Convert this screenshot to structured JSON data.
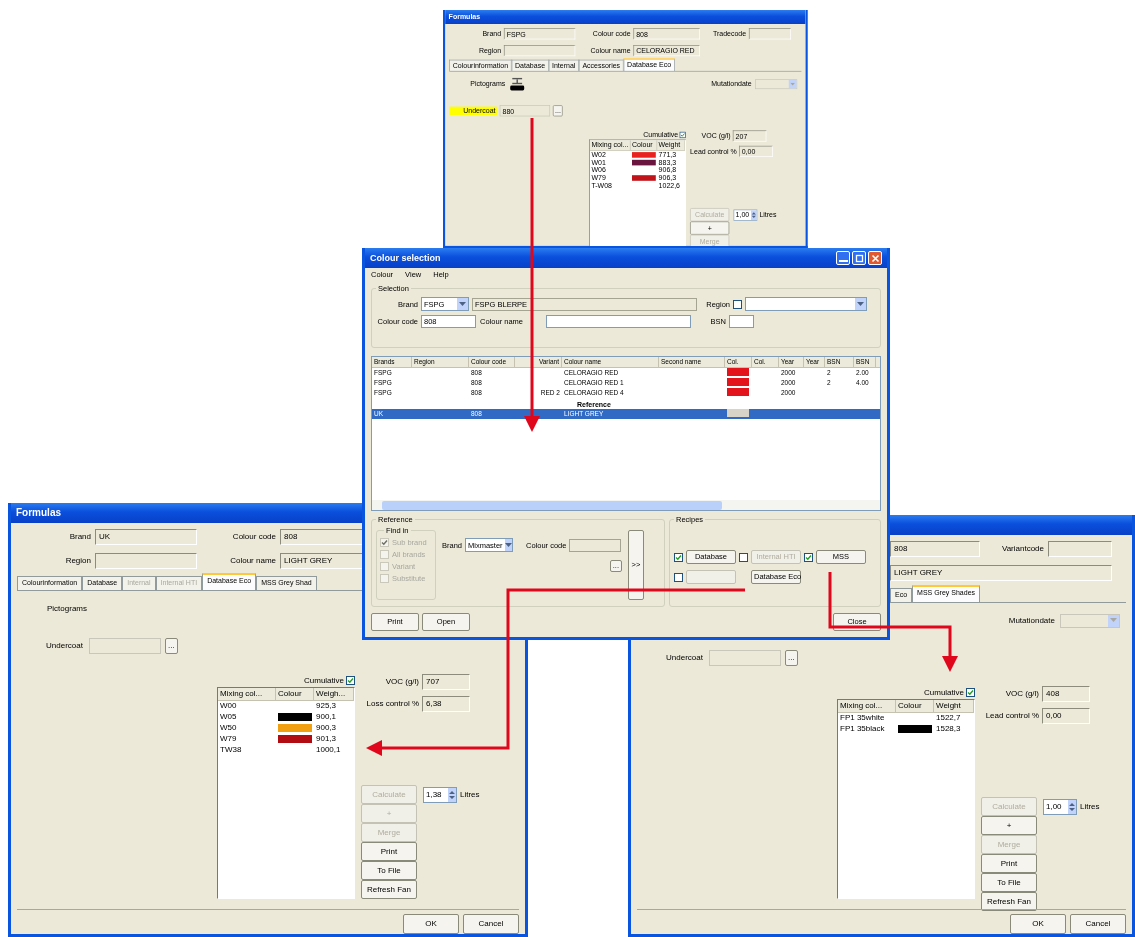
{
  "formula_windows": [
    {
      "title": "Formulas",
      "header": [
        [
          {
            "label": "Brand",
            "value": "FSPG"
          },
          {
            "label": "Colour code",
            "value": "808"
          },
          {
            "label": "Tradecode"
          }
        ],
        [
          {
            "label": "Region"
          },
          {
            "label": "Colour name",
            "value": "CELORAGIO RED"
          }
        ]
      ],
      "tabs": [
        {
          "label": "Colourinformation",
          "selected": false,
          "disabled": false
        },
        {
          "label": "Database",
          "selected": false,
          "disabled": false
        },
        {
          "label": "Internal",
          "selected": false,
          "disabled": false
        },
        {
          "label": "Accessories",
          "selected": false,
          "disabled": false
        },
        {
          "label": "Database Eco",
          "selected": true,
          "disabled": false
        }
      ],
      "pictograms": {
        "label": "Pictograms",
        "symbol_shown": true
      },
      "mutationdate": {
        "label": "Mutationdate"
      },
      "undercoat": {
        "label": "Undercoat",
        "value": "880",
        "button": "...",
        "highlighted": true
      },
      "cumulative": {
        "label": "Cumulative",
        "checked": true
      },
      "mix_table": {
        "columns": [
          "Mixing col...",
          "Colour",
          "Weight"
        ],
        "rows": [
          {
            "mixing_colour": "W02",
            "color": "#e8231f",
            "weight": "771,3"
          },
          {
            "mixing_colour": "W01",
            "color": "#6a1440",
            "weight": "883,3"
          },
          {
            "mixing_colour": "W06",
            "weight": "906,8"
          },
          {
            "mixing_colour": "W79",
            "color": "#c0141a",
            "weight": "906,3"
          },
          {
            "mixing_colour": "T-W08",
            "weight": "1022,6"
          }
        ]
      },
      "voc": {
        "label": "VOC (g/l)",
        "value": "207"
      },
      "lead": {
        "label": "Lead control %",
        "value": "0,00"
      },
      "side_buttons": [
        {
          "label": "Calculate",
          "disabled": true
        },
        {
          "label": "+",
          "disabled": false
        },
        {
          "label": "Merge",
          "disabled": true
        }
      ],
      "quantity": {
        "value": "1,00",
        "unit": "Litres"
      }
    },
    {
      "title": "Formulas",
      "header": [
        [
          {
            "label": "Brand",
            "value": "UK"
          },
          {
            "label": "Colour code",
            "value": "808"
          }
        ],
        [
          {
            "label": "Region"
          },
          {
            "label": "Colour name",
            "value": "LIGHT GREY"
          }
        ]
      ],
      "tabs": [
        {
          "label": "Colourinformation",
          "selected": false,
          "disabled": false
        },
        {
          "label": "Database",
          "selected": false,
          "disabled": false
        },
        {
          "label": "Internal",
          "selected": false,
          "disabled": true
        },
        {
          "label": "Internal HTI",
          "selected": false,
          "disabled": true
        },
        {
          "label": "Database Eco",
          "selected": true,
          "disabled": false
        },
        {
          "label": "MSS Grey Shad",
          "selected": false,
          "disabled": false
        }
      ],
      "pictograms": {
        "label": "Pictograms"
      },
      "undercoat": {
        "label": "Undercoat",
        "button": "...",
        "highlighted": false
      },
      "cumulative": {
        "label": "Cumulative",
        "checked": true
      },
      "mix_table": {
        "columns": [
          "Mixing col...",
          "Colour",
          "Weigh..."
        ],
        "rows": [
          {
            "mixing_colour": "W00",
            "weight": "925,3"
          },
          {
            "mixing_colour": "W05",
            "color": "#000000",
            "weight": "900,1"
          },
          {
            "mixing_colour": "W50",
            "color": "#f0a010",
            "weight": "900,3"
          },
          {
            "mixing_colour": "W79",
            "color": "#b00c12",
            "weight": "901,3"
          },
          {
            "mixing_colour": "TW38",
            "weight": "1000,1"
          }
        ]
      },
      "voc": {
        "label": "VOC (g/l)",
        "value": "707"
      },
      "lead": {
        "label": "Loss control %",
        "value": "6,38"
      },
      "side_buttons": [
        {
          "label": "Calculate",
          "disabled": true
        },
        {
          "label": "+",
          "disabled": true
        },
        {
          "label": "Merge",
          "disabled": true
        },
        {
          "label": "Print",
          "disabled": false
        },
        {
          "label": "To File",
          "disabled": false
        },
        {
          "label": "Refresh Fan",
          "disabled": false
        }
      ],
      "quantity": {
        "value": "1,38",
        "unit": "Litres"
      },
      "footer_buttons": [
        "OK",
        "Cancel"
      ]
    },
    {
      "header": [
        [
          {
            "value": "808"
          },
          {
            "label": "Variantcode"
          }
        ],
        [
          {
            "value": "LIGHT GREY"
          }
        ]
      ],
      "tabs": [
        {
          "label": "Eco",
          "selected": false,
          "disabled": false
        },
        {
          "label": "MSS Grey Shades",
          "selected": true,
          "disabled": false
        }
      ],
      "mutationdate": {
        "label": "Mutationdate"
      },
      "undercoat": {
        "label": "Undercoat",
        "button": "...",
        "highlighted": false
      },
      "cumulative": {
        "label": "Cumulative",
        "checked": true
      },
      "mix_table": {
        "columns": [
          "Mixing col...",
          "Colour",
          "Weight"
        ],
        "rows": [
          {
            "mixing_colour": "FP1 35white",
            "weight": "1522,7"
          },
          {
            "mixing_colour": "FP1 35black",
            "color": "#000000",
            "weight": "1528,3"
          }
        ]
      },
      "voc": {
        "label": "VOC (g/l)",
        "value": "408"
      },
      "lead": {
        "label": "Lead control %",
        "value": "0,00"
      },
      "side_buttons": [
        {
          "label": "Calculate",
          "disabled": true
        },
        {
          "label": "+",
          "disabled": false
        },
        {
          "label": "Merge",
          "disabled": true
        },
        {
          "label": "Print",
          "disabled": false
        },
        {
          "label": "To File",
          "disabled": false
        },
        {
          "label": "Refresh Fan",
          "disabled": false
        }
      ],
      "quantity": {
        "value": "1,00",
        "unit": "Litres"
      },
      "footer_buttons": [
        "OK",
        "Cancel"
      ]
    }
  ],
  "colour_selection": {
    "title": "Colour selection",
    "menu": [
      "Colour",
      "View",
      "Help"
    ],
    "selection": {
      "label": "Selection",
      "brand": {
        "label": "Brand",
        "value": "FSPG"
      },
      "brand_name": "FSPG BLERPE",
      "region": {
        "label": "Region",
        "checked": false
      },
      "colour_code": {
        "label": "Colour code",
        "value": "808"
      },
      "colour_name": {
        "label": "Colour name"
      },
      "bsn": {
        "label": "BSN"
      }
    },
    "results": {
      "columns": [
        "Brands",
        "Region",
        "Colour code",
        "Variant",
        "Colour name",
        "Second name",
        "Col.",
        "Col.",
        "Year",
        "Year",
        "BSN",
        "BSN"
      ],
      "rows": [
        {
          "kind": "data",
          "selected": false,
          "brand": "FSPG",
          "colour_code": "808",
          "colour_name": "CELORAGIO RED",
          "color": "#e3141b",
          "year": "2000",
          "bsn": "2",
          "bsn_2": "2.00"
        },
        {
          "kind": "data",
          "selected": false,
          "brand": "FSPG",
          "colour_code": "808",
          "colour_name": "CELORAGIO RED 1",
          "color": "#e3141b",
          "year": "2000",
          "bsn": "2",
          "bsn_2": "4.00"
        },
        {
          "kind": "data",
          "selected": false,
          "brand": "FSPG",
          "colour_code": "808",
          "variant": "RED 2",
          "colour_name": "CELORAGIO RED 4",
          "color": "#e3141b",
          "year": "2000"
        },
        {
          "kind": "section",
          "label": "Reference"
        },
        {
          "kind": "data",
          "selected": true,
          "brand": "UK",
          "colour_code": "808",
          "colour_name": "LIGHT GREY",
          "color": "#d8d4c8"
        }
      ]
    },
    "reference": {
      "label": "Reference",
      "find_in": {
        "label": "Find in",
        "options": [
          {
            "label": "Sub brand",
            "checked": true,
            "disabled": true
          },
          {
            "label": "All brands",
            "checked": false,
            "disabled": true
          },
          {
            "label": "Variant",
            "checked": false,
            "disabled": true
          },
          {
            "label": "Substitute",
            "checked": false,
            "disabled": true
          }
        ]
      },
      "brand": {
        "label": "Brand",
        "value": "Mixmaster"
      },
      "colour_code": {
        "label": "Colour code"
      },
      "browse_button": "...",
      "go_button": ">>"
    },
    "recipes": {
      "label": "Recipes",
      "rows": [
        [
          {
            "label": "Database",
            "checked": true,
            "disabled": false
          },
          {
            "label": "Internal HTI",
            "checked": false,
            "disabled": true
          },
          {
            "label": "MSS",
            "checked": true,
            "disabled": false
          }
        ],
        [
          {
            "checked": false,
            "disabled": true
          },
          {
            "label": "Database Eco",
            "disabled": false
          }
        ]
      ]
    },
    "buttons": [
      "Print",
      "Open"
    ],
    "close_button": "Close"
  }
}
